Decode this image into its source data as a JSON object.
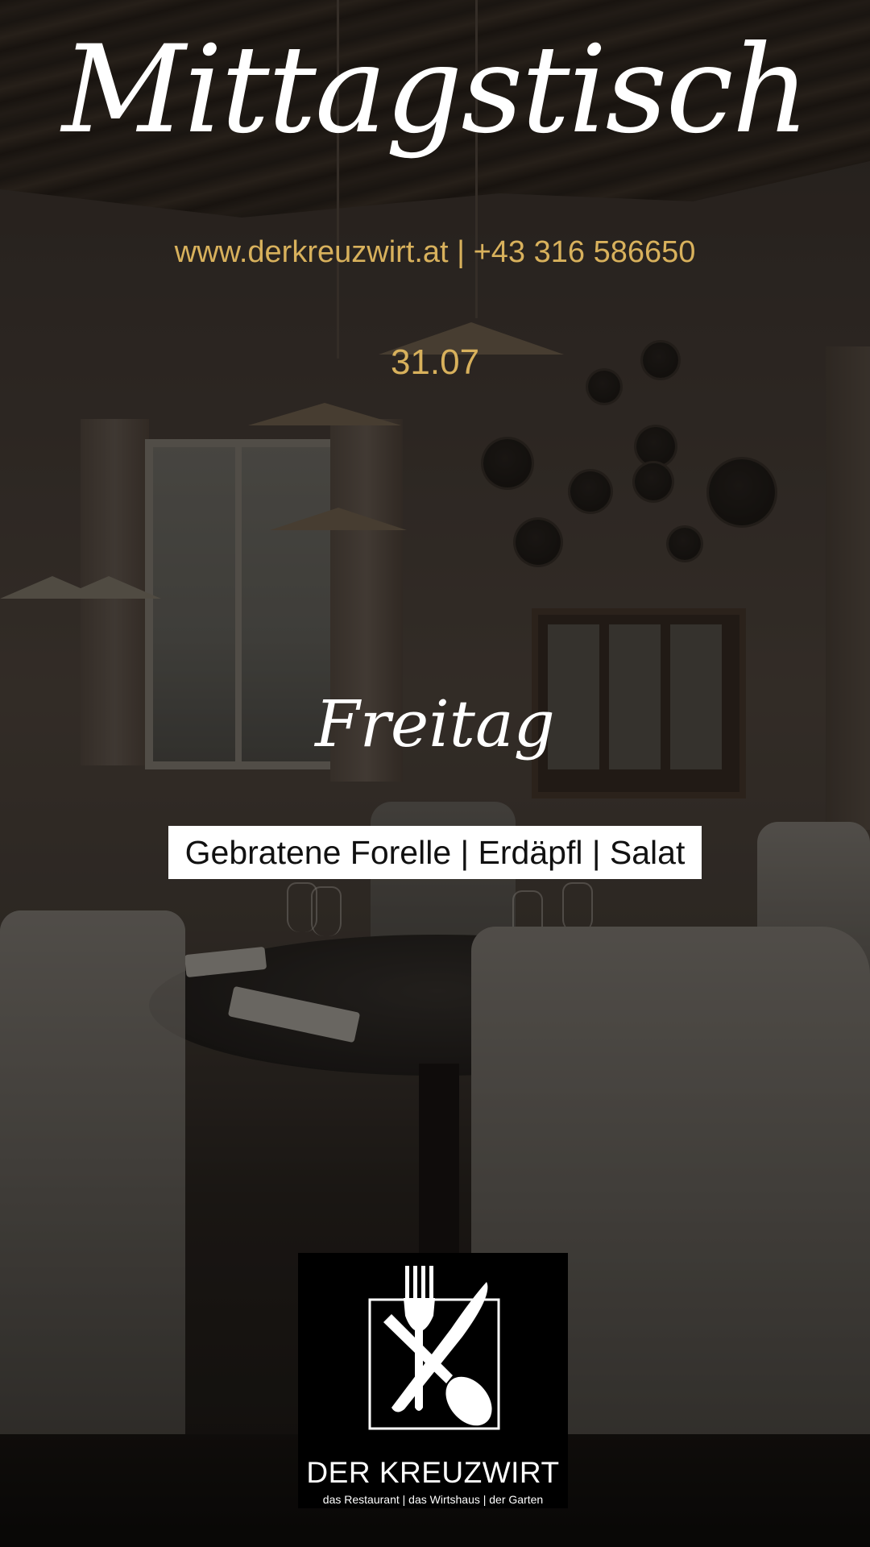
{
  "header": {
    "title": "Mittagstisch",
    "contact": "www.derkreuzwirt.at | +43 316 586650"
  },
  "day": {
    "date": "31.07",
    "weekday": "Freitag"
  },
  "menu": {
    "dish": "Gebratene Forelle | Erdäpfl | Salat"
  },
  "logo": {
    "icon": "cutlery-icon",
    "name": "DER KREUZWIRT",
    "tagline": "das Restaurant | das Wirtshaus | der Garten"
  },
  "colors": {
    "accent": "#d8b15c",
    "title": "#ffffff",
    "menu_box": "#ffffff",
    "logo_bg": "#000000"
  }
}
